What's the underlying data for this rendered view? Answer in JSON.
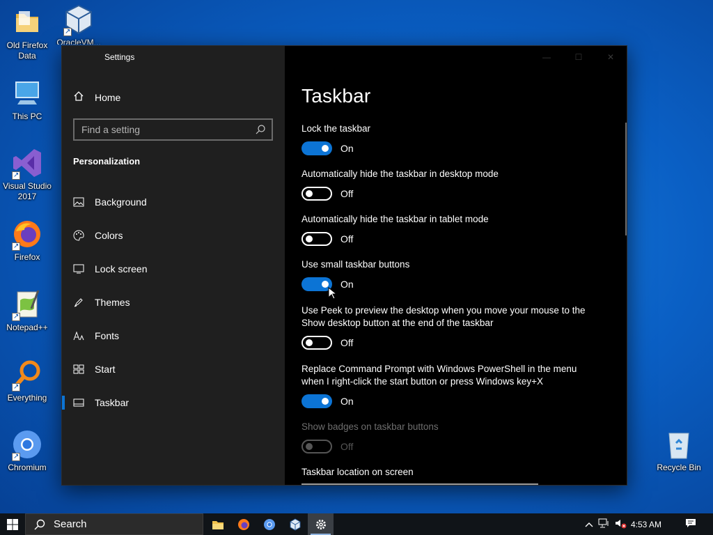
{
  "desktop": {
    "icons": [
      {
        "label": "Old Firefox Data",
        "icon": "folder-icon"
      },
      {
        "label": "OracleVM...",
        "icon": "virtualbox-icon"
      },
      {
        "label": "This PC",
        "icon": "computer-icon"
      },
      {
        "label": "Visual Studio 2017",
        "icon": "visual-studio-icon"
      },
      {
        "label": "Firefox",
        "icon": "firefox-icon"
      },
      {
        "label": "Notepad++",
        "icon": "notepadpp-icon"
      },
      {
        "label": "Everything",
        "icon": "everything-icon"
      },
      {
        "label": "Chromium",
        "icon": "chromium-icon"
      },
      {
        "label": "Recycle Bin",
        "icon": "recycle-bin-icon"
      }
    ]
  },
  "window": {
    "title": "Settings",
    "controls": {
      "minimize": "—",
      "maximize": "☐",
      "close": "✕"
    }
  },
  "sidebar": {
    "home_label": "Home",
    "search_placeholder": "Find a setting",
    "section_title": "Personalization",
    "items": [
      {
        "label": "Background",
        "icon": "background-icon"
      },
      {
        "label": "Colors",
        "icon": "colors-icon"
      },
      {
        "label": "Lock screen",
        "icon": "lock-screen-icon"
      },
      {
        "label": "Themes",
        "icon": "themes-icon"
      },
      {
        "label": "Fonts",
        "icon": "fonts-icon"
      },
      {
        "label": "Start",
        "icon": "start-icon"
      },
      {
        "label": "Taskbar",
        "icon": "taskbar-icon",
        "active": true
      }
    ]
  },
  "content": {
    "title": "Taskbar",
    "settings": [
      {
        "label": "Lock the taskbar",
        "state": "On"
      },
      {
        "label": "Automatically hide the taskbar in desktop mode",
        "state": "Off"
      },
      {
        "label": "Automatically hide the taskbar in tablet mode",
        "state": "Off"
      },
      {
        "label": "Use small taskbar buttons",
        "state": "On"
      },
      {
        "label": "Use Peek to preview the desktop when you move your mouse to the Show desktop button at the end of the taskbar",
        "state": "Off"
      },
      {
        "label": "Replace Command Prompt with Windows PowerShell in the menu when I right-click the start button or press Windows key+X",
        "state": "On"
      },
      {
        "label": "Show badges on taskbar buttons",
        "state": "Off",
        "disabled": true
      }
    ],
    "location_label": "Taskbar location on screen"
  },
  "taskbar": {
    "search_label": "Search",
    "apps": [
      "file-explorer-icon",
      "firefox-icon",
      "chromium-icon",
      "virtualbox-icon",
      "settings-icon"
    ],
    "clock": "4:53 AM"
  },
  "colors": {
    "accent": "#0c74d5",
    "sidebar": "#1f1f1f",
    "content": "#000000"
  }
}
